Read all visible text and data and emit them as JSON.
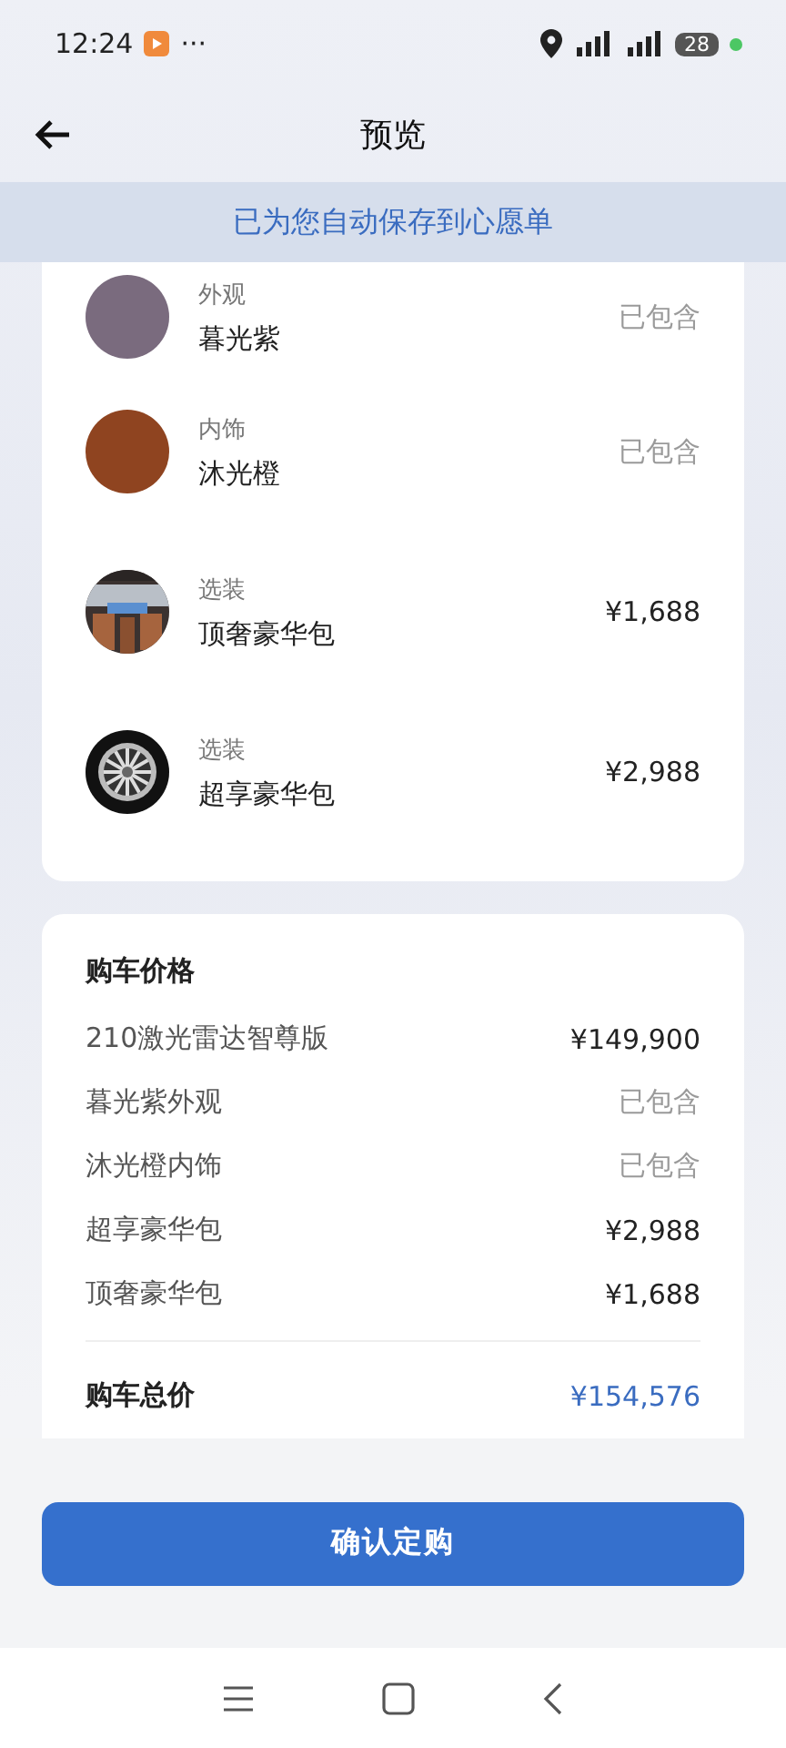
{
  "status_bar": {
    "time": "12:24",
    "more": "···",
    "battery": "28"
  },
  "header": {
    "title": "预览"
  },
  "banner": {
    "text": "已为您自动保存到心愿单"
  },
  "items": [
    {
      "kind": "swatch",
      "color": "#7a6b7e",
      "category": "外观",
      "name": "暮光紫",
      "price": "已包含",
      "included": true
    },
    {
      "kind": "swatch",
      "color": "#8f4420",
      "category": "内饰",
      "name": "沐光橙",
      "price": "已包含",
      "included": true
    },
    {
      "kind": "interior",
      "category": "选装",
      "name": "顶奢豪华包",
      "price": "¥1,688",
      "included": false
    },
    {
      "kind": "wheel",
      "category": "选装",
      "name": "超享豪华包",
      "price": "¥2,988",
      "included": false
    }
  ],
  "price_card": {
    "title": "购车价格",
    "lines": [
      {
        "label": "210激光雷达智尊版",
        "value": "¥149,900",
        "included": false
      },
      {
        "label": "暮光紫外观",
        "value": "已包含",
        "included": true
      },
      {
        "label": "沐光橙内饰",
        "value": "已包含",
        "included": true
      },
      {
        "label": "超享豪华包",
        "value": "¥2,988",
        "included": false
      },
      {
        "label": "顶奢豪华包",
        "value": "¥1,688",
        "included": false
      }
    ],
    "total_label": "购车总价",
    "total_value": "¥154,576"
  },
  "confirm_button": "确认定购"
}
